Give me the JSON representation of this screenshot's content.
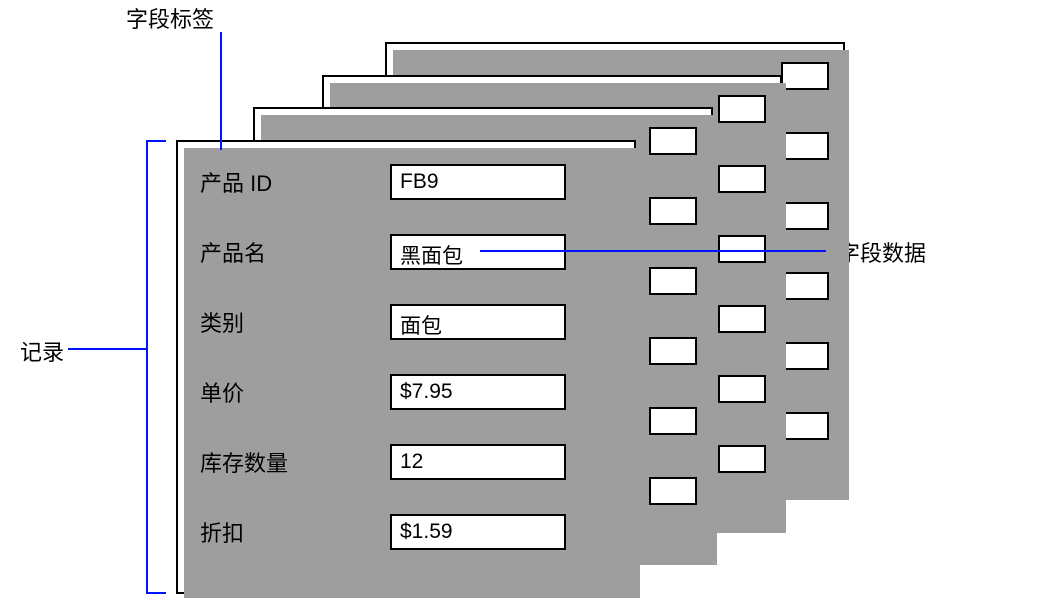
{
  "callouts": {
    "field_label": "字段标签",
    "record": "记录",
    "field_data": "字段数据"
  },
  "fields": [
    {
      "label": "产品 ID",
      "value": "FB9"
    },
    {
      "label": "产品名",
      "value": "黑面包"
    },
    {
      "label": "类别",
      "value": "面包"
    },
    {
      "label": "单价",
      "value": "$7.95"
    },
    {
      "label": "库存数量",
      "value": "12"
    },
    {
      "label": "折扣",
      "value": "$1.59"
    }
  ]
}
